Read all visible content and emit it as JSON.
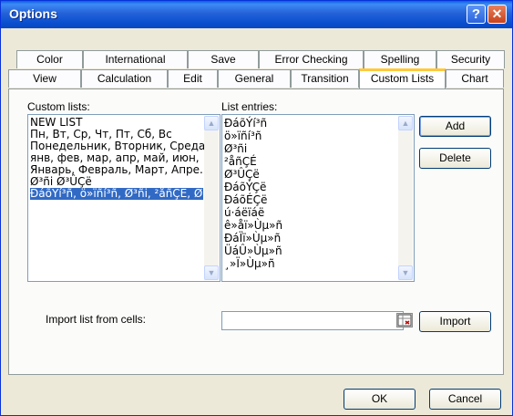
{
  "window": {
    "title": "Options",
    "help_glyph": "?",
    "close_glyph": "✕"
  },
  "tabs_back": [
    "Color",
    "International",
    "Save",
    "Error Checking",
    "Spelling",
    "Security"
  ],
  "tabs_front": [
    "View",
    "Calculation",
    "Edit",
    "General",
    "Transition",
    "Custom Lists",
    "Chart"
  ],
  "active_tab": "Custom Lists",
  "custom_lists": {
    "label": "Custom lists:",
    "items": [
      "NEW LIST",
      "Пн, Вт, Ср, Чт, Пт, Сб, Вс",
      "Понедельник, Вторник, Среда",
      "янв, фев, мар, апр, май, июн,",
      "Январь, Февраль, Март, Апре.",
      "Ø³ñi Ø³ÛÇë",
      "ÐáõÝí³ñ, ö»ïñí³ñ, Ø³ñi, ²åñÇÉ, Ø"
    ],
    "selected_index": 6
  },
  "list_entries": {
    "label": "List entries:",
    "items": [
      "ÐáõÝí³ñ",
      "ö»ïñí³ñ",
      "Ø³ñi",
      "²åñÇÉ",
      "Ø³ÛÇë",
      "ÐáõÝÇë",
      "ÐáõÉÇë",
      "ú·áëïáë",
      "ê»åï»Ùµ»ñ",
      "ÐáÏï»Ùµ»ñ",
      "ÜáÛ»Ùµ»ñ",
      "¸»Ï»Ùµ»ñ"
    ]
  },
  "buttons": {
    "add": "Add",
    "delete": "Delete",
    "import": "Import",
    "ok": "OK",
    "cancel": "Cancel"
  },
  "import": {
    "label": "Import list from cells:",
    "value": ""
  },
  "scroll": {
    "up": "▲",
    "down": "▼"
  },
  "colors": {
    "titlebar": "#0a4fcf",
    "selection": "#316ac5",
    "tab_highlight": "#ffc83c",
    "dialog_bg": "#ece9d8"
  },
  "icons": {
    "help": "help-icon",
    "close": "close-icon",
    "range_picker": "range-picker-icon"
  }
}
